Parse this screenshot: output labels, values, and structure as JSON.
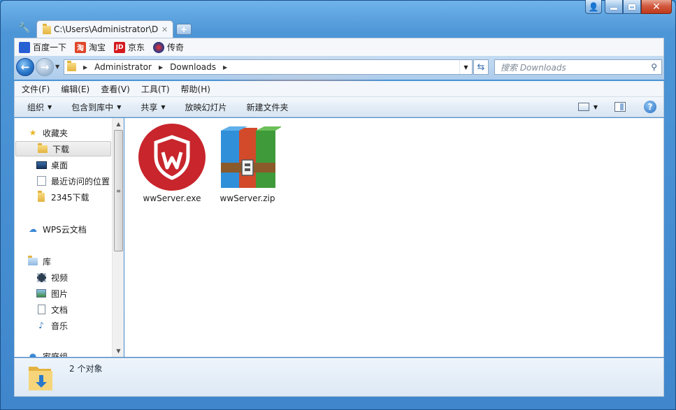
{
  "window": {
    "caption_user_label": "👤",
    "close_label": "✕"
  },
  "tab": {
    "title": "C:\\Users\\Administrator\\D",
    "close": "✕",
    "new_tab": "+"
  },
  "bookmarks": [
    {
      "label": "百度一下",
      "icon": "baidu-paw-icon",
      "color": "#2a5ed6"
    },
    {
      "label": "淘宝",
      "icon": "taobao-icon",
      "color": "#e0462a"
    },
    {
      "label": "京东",
      "icon": "jd-icon",
      "color": "#d51a1f"
    },
    {
      "label": "传奇",
      "icon": "game-icon",
      "color": "#1e3a8a"
    }
  ],
  "address": {
    "crumbs": [
      "Administrator",
      "Downloads"
    ]
  },
  "search": {
    "placeholder": "搜索 Downloads"
  },
  "menu": [
    "文件(F)",
    "编辑(E)",
    "查看(V)",
    "工具(T)",
    "帮助(H)"
  ],
  "commands": [
    {
      "label": "组织",
      "dropdown": true
    },
    {
      "label": "包含到库中",
      "dropdown": true
    },
    {
      "label": "共享",
      "dropdown": true
    },
    {
      "label": "放映幻灯片",
      "dropdown": false
    },
    {
      "label": "新建文件夹",
      "dropdown": false
    }
  ],
  "nav": {
    "favorites": "收藏夹",
    "downloads": "下载",
    "desktop": "桌面",
    "recent": "最近访问的位置",
    "dl2345": "2345下载",
    "wps": "WPS云文档",
    "libraries": "库",
    "videos": "视频",
    "pictures": "图片",
    "documents": "文档",
    "music": "音乐",
    "homegroup": "家庭组"
  },
  "files": [
    {
      "name": "wwServer.exe",
      "icon": "wwserver-shield-icon"
    },
    {
      "name": "wwServer.zip",
      "icon": "winrar-archive-icon"
    }
  ],
  "details": {
    "count": "2 个对象"
  }
}
